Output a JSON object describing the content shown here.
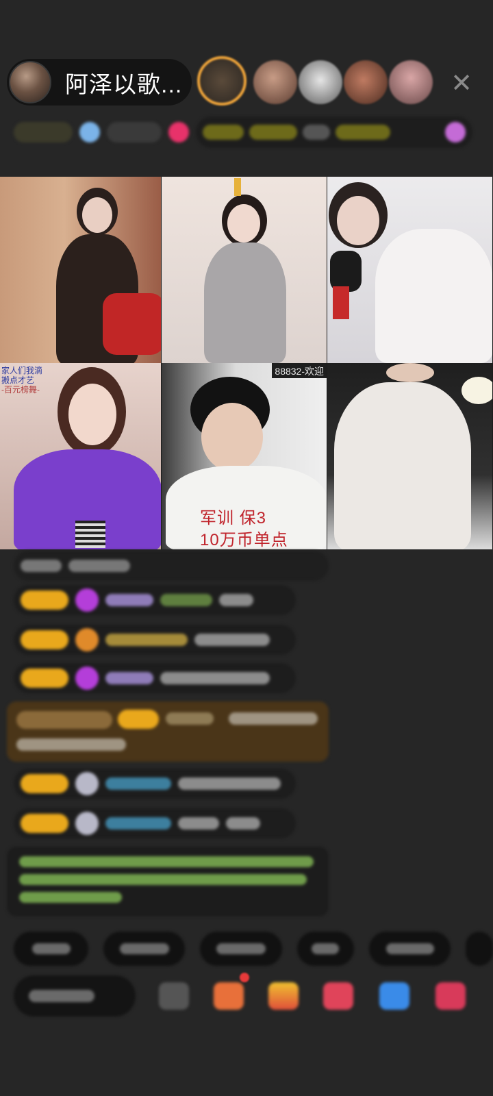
{
  "header": {
    "host_name": "阿泽以歌...",
    "close_icon": "close-icon"
  },
  "grid": {
    "tile5_corner_label": "88832-欢迎",
    "tile5_promo_line1": "军训   保3",
    "tile5_promo_line2": "10万币单点",
    "tile4_overlay_line1": "家人们我滴",
    "tile4_overlay_line2": "搬点才艺",
    "tile4_overlay_line3": "-百元榜舞-"
  },
  "colors": {
    "background": "#262626",
    "badge_yellow": "#e9a81c",
    "promo_red": "#c0232b",
    "highlight_brown": "#4a3518"
  }
}
